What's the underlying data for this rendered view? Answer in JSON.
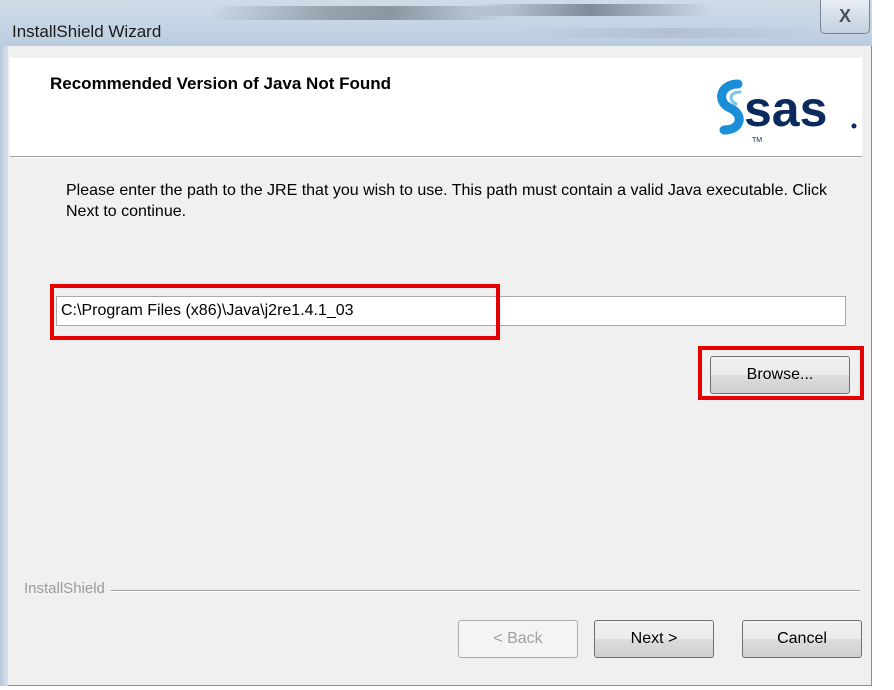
{
  "window": {
    "title": "InstallShield Wizard",
    "close_glyph": "X"
  },
  "header": {
    "title": "Recommended Version of Java Not Found",
    "logo_text": "sas"
  },
  "body": {
    "instructions": "Please enter the path to the JRE that you wish to use.  This path must contain a valid Java executable.  Click Next to continue.",
    "jre_path": "C:\\Program Files (x86)\\Java\\j2re1.4.1_03",
    "browse_label": "Browse..."
  },
  "footer": {
    "brand_label": "InstallShield",
    "back_label": "< Back",
    "next_label": "Next >",
    "cancel_label": "Cancel"
  },
  "colors": {
    "highlight": "#e60000",
    "sas_blue": "#1a8fd8",
    "sas_text": "#0a2a5e"
  }
}
